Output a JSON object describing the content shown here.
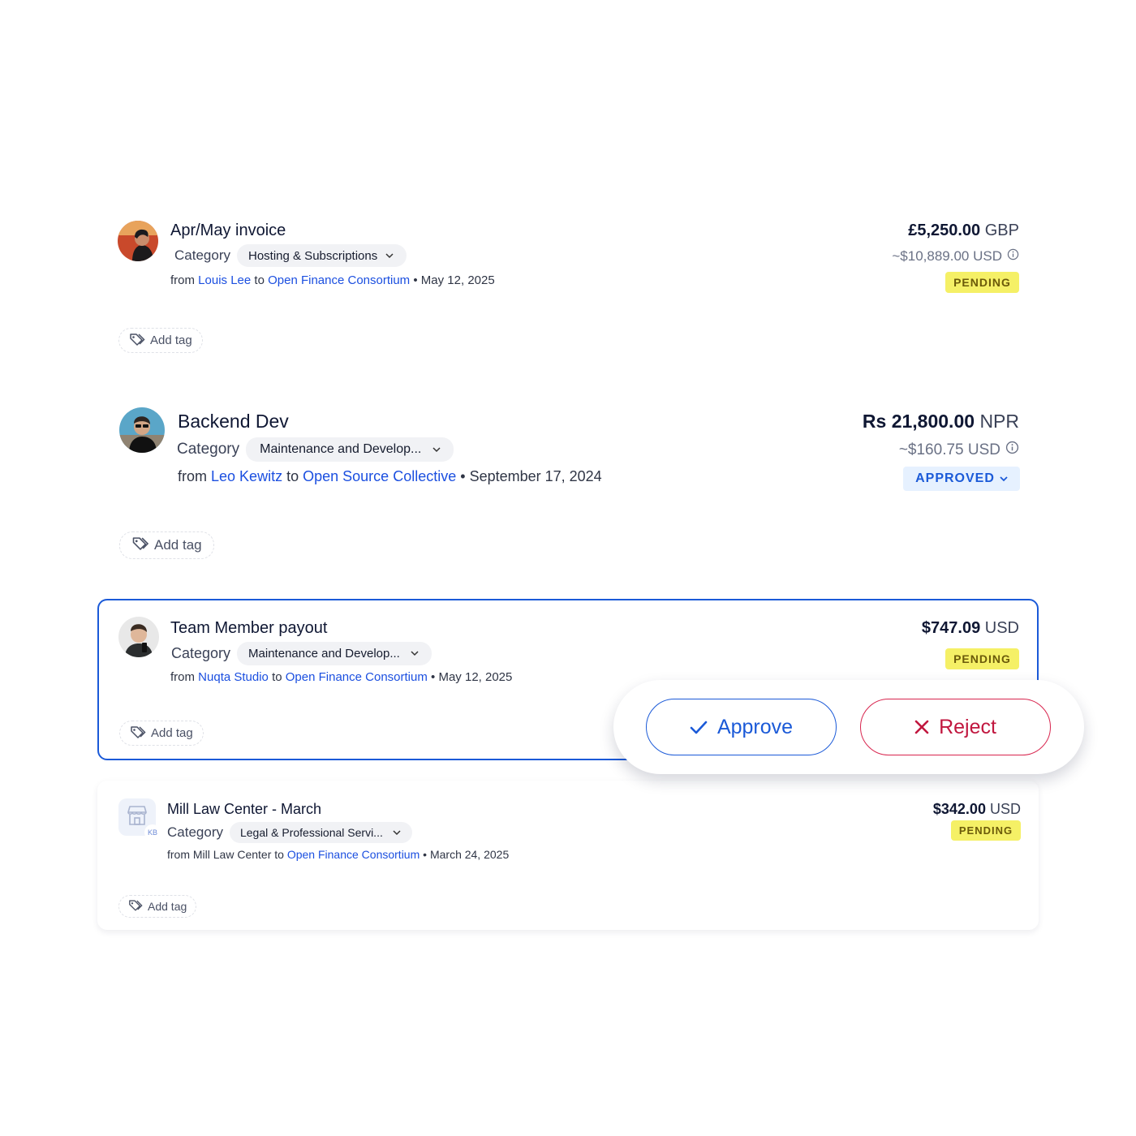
{
  "expenses": [
    {
      "title": "Apr/May invoice",
      "category_label": "Category",
      "category_value": "Hosting & Subscriptions",
      "from_word": "from",
      "from_name": "Louis Lee",
      "to_word": "to",
      "to_name": "Open Finance Consortium",
      "bullet": "•",
      "date": "May 12, 2025",
      "amount": "£5,250.00",
      "currency": "GBP",
      "converted": "~$10,889.00 USD",
      "status": "PENDING",
      "add_tag": "Add tag"
    },
    {
      "title": "Backend Dev",
      "category_label": "Category",
      "category_value": "Maintenance and Develop...",
      "from_word": "from",
      "from_name": "Leo Kewitz",
      "to_word": "to",
      "to_name": "Open Source Collective",
      "bullet": "•",
      "date": "September 17, 2024",
      "amount": "Rs 21,800.00",
      "currency": "NPR",
      "converted": "~$160.75 USD",
      "status": "APPROVED",
      "add_tag": "Add tag"
    },
    {
      "title": "Team Member payout",
      "category_label": "Category",
      "category_value": "Maintenance and Develop...",
      "from_word": "from",
      "from_name": "Nuqta Studio",
      "to_word": "to",
      "to_name": "Open Finance Consortium",
      "bullet": "•",
      "date": "May 12, 2025",
      "amount": "$747.09",
      "currency": "USD",
      "status": "PENDING",
      "add_tag": "Add tag"
    },
    {
      "title": "Mill Law Center - March",
      "avatar_initials": "KB",
      "category_label": "Category",
      "category_value": "Legal & Professional Servi...",
      "from_word": "from",
      "from_name": "Mill Law Center",
      "to_word": "to",
      "to_name": "Open Finance Consortium",
      "bullet": "•",
      "date": "March 24, 2025",
      "amount": "$342.00",
      "currency": "USD",
      "status": "PENDING",
      "add_tag": "Add tag"
    }
  ],
  "actions": {
    "approve_label": "Approve",
    "reject_label": "Reject"
  },
  "colors": {
    "link": "#1b4fe0",
    "pending_bg": "#f5f066",
    "approved_bg": "#e6f1ff",
    "approved_text": "#1b5ad8",
    "selected_border": "#1b5ad8",
    "reject": "#c1173f"
  }
}
